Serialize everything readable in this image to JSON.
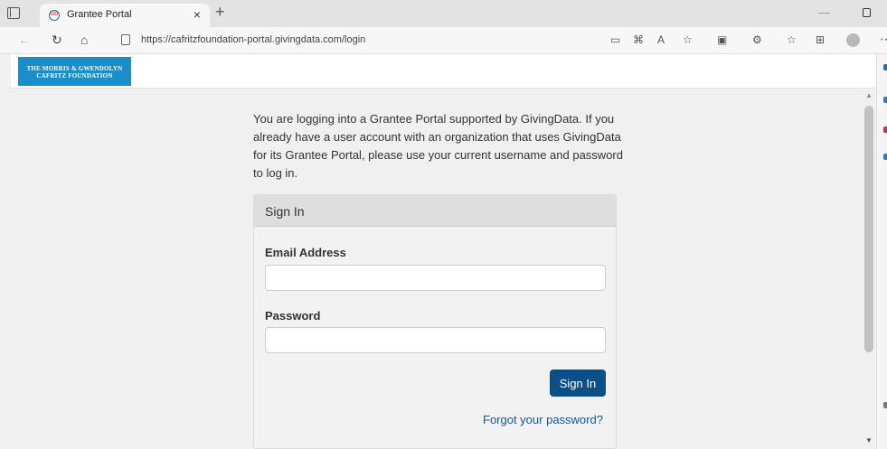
{
  "browser": {
    "tab_title": "Grantee Portal",
    "tab_favicon_text": "GD",
    "tab_close": "×",
    "new_tab": "+",
    "url": "https://cafritzfoundation-portal.givingdata.com/login"
  },
  "header": {
    "logo_line1": "THE MORRIS & GWENDOLYN",
    "logo_line2": "CAFRITZ FOUNDATION"
  },
  "main": {
    "intro_text": "You are logging into a Grantee Portal supported by GivingData. If you already have a user account with an organization that uses GivingData for its Grantee Portal, please use your current username and password to log in."
  },
  "signin": {
    "title": "Sign In",
    "email_label": "Email Address",
    "email_value": "",
    "password_label": "Password",
    "password_value": "",
    "button_label": "Sign In",
    "forgot_link": "Forgot your password?"
  },
  "colors": {
    "brand_blue": "#1a8ec9",
    "button_blue": "#0b4f87",
    "link_blue": "#14579a"
  },
  "icons": [
    "tab-actions-icon",
    "back-icon",
    "refresh-icon",
    "home-icon",
    "lock-icon",
    "read-aloud-icon",
    "favorites-icon",
    "collections-icon",
    "profile-icon"
  ]
}
